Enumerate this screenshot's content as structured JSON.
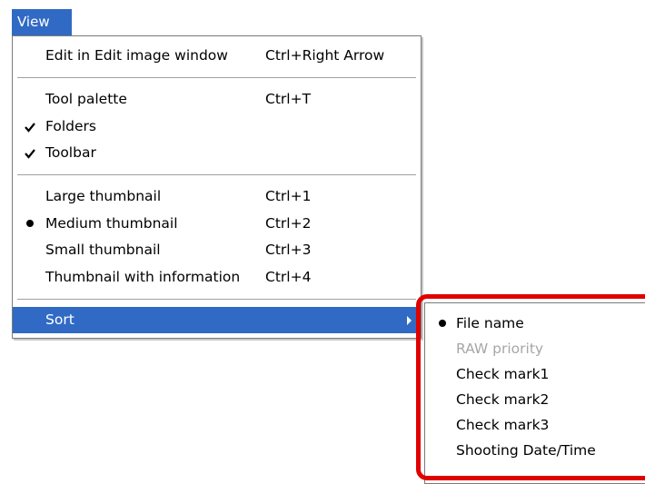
{
  "menubar": {
    "view_label": "View"
  },
  "menu": {
    "items": [
      {
        "label": "Edit in Edit image window",
        "shortcut": "Ctrl+Right Arrow"
      },
      {
        "label": "Tool palette",
        "shortcut": "Ctrl+T"
      },
      {
        "label": "Folders",
        "shortcut": "",
        "checked": true
      },
      {
        "label": "Toolbar",
        "shortcut": "",
        "checked": true
      },
      {
        "label": "Large thumbnail",
        "shortcut": "Ctrl+1"
      },
      {
        "label": "Medium thumbnail",
        "shortcut": "Ctrl+2",
        "selected": true
      },
      {
        "label": "Small thumbnail",
        "shortcut": "Ctrl+3"
      },
      {
        "label": "Thumbnail with information",
        "shortcut": "Ctrl+4"
      },
      {
        "label": "Sort",
        "shortcut": "",
        "highlighted": true,
        "has_submenu": true
      }
    ]
  },
  "submenu": {
    "items": [
      {
        "label": "File name",
        "selected": true
      },
      {
        "label": "RAW priority",
        "disabled": true
      },
      {
        "label": "Check mark1"
      },
      {
        "label": "Check mark2"
      },
      {
        "label": "Check mark3"
      },
      {
        "label": "Shooting Date/Time"
      }
    ]
  },
  "colors": {
    "highlight": "#316ac5",
    "annotation": "#e00000",
    "disabled_text": "#a7a7a7"
  },
  "icons": {
    "check": "check-icon",
    "radio": "bullet-icon",
    "submenu_arrow": "chevron-right-icon"
  }
}
